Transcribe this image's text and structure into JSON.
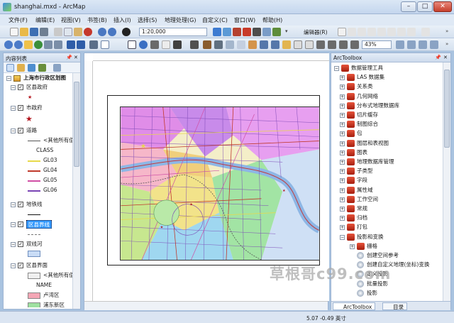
{
  "window": {
    "title": "shanghai.mxd - ArcMap"
  },
  "menu": [
    "文件(F)",
    "编辑(E)",
    "视图(V)",
    "书签(B)",
    "插入(I)",
    "选择(S)",
    "地理处理(G)",
    "自定义(C)",
    "窗口(W)",
    "帮助(H)"
  ],
  "toolbar": {
    "scale": "1:20,000",
    "editor_label": "编辑器(R)",
    "zoom_percent": "43%"
  },
  "toc": {
    "title": "内容列表",
    "dataframe": "上海市行政区划图",
    "items": [
      {
        "label": "区县政府",
        "checked": true
      },
      {
        "label": "市政府",
        "checked": true
      },
      {
        "label": "道路",
        "checked": true
      },
      {
        "label": "<其他所有值>"
      },
      {
        "label": "CLASS"
      },
      {
        "label": "GL03"
      },
      {
        "label": "GL04"
      },
      {
        "label": "GL05"
      },
      {
        "label": "GL06"
      },
      {
        "label": "地铁线",
        "checked": true
      },
      {
        "label": "区县界线",
        "checked": true,
        "selected": true
      },
      {
        "label": "双线河",
        "checked": true
      },
      {
        "label": "区县界面",
        "checked": true
      },
      {
        "label": "<其他所有值>"
      },
      {
        "label": "NAME"
      },
      {
        "label": "卢湾区"
      },
      {
        "label": "浦东新区"
      },
      {
        "label": "虹口区"
      }
    ],
    "colors": {
      "gl03": "#e8d94a",
      "gl04": "#c0392b",
      "gl05": "#d04fa5",
      "gl06": "#7a45b5",
      "luwan": "#f4a6b5",
      "pudong": "#9ee0a0",
      "hongkou": "#c5d5f3"
    }
  },
  "toolbox": {
    "title": "ArcToolbox",
    "items": [
      {
        "label": "数据管理工具",
        "level": 0,
        "expanded": true
      },
      {
        "label": "LAS 数据集",
        "level": 1
      },
      {
        "label": "关系类",
        "level": 1
      },
      {
        "label": "几何网络",
        "level": 1
      },
      {
        "label": "分布式地理数据库",
        "level": 1
      },
      {
        "label": "切片缓存",
        "level": 1
      },
      {
        "label": "制图综合",
        "level": 1
      },
      {
        "label": "包",
        "level": 1
      },
      {
        "label": "图层和表视图",
        "level": 1
      },
      {
        "label": "图表",
        "level": 1
      },
      {
        "label": "地理数据库管理",
        "level": 1
      },
      {
        "label": "子类型",
        "level": 1
      },
      {
        "label": "字段",
        "level": 1
      },
      {
        "label": "属性域",
        "level": 1
      },
      {
        "label": "工作空间",
        "level": 1
      },
      {
        "label": "常规",
        "level": 1
      },
      {
        "label": "归档",
        "level": 1
      },
      {
        "label": "打包",
        "level": 1
      },
      {
        "label": "投影和变换",
        "level": 1,
        "expanded": true
      },
      {
        "label": "栅格",
        "level": 2
      },
      {
        "label": "创建空间参考",
        "level": 2,
        "tool": true
      },
      {
        "label": "创建自定义地理(坐标)变换",
        "level": 2,
        "tool": true
      },
      {
        "label": "定义投影",
        "level": 2,
        "tool": true
      },
      {
        "label": "批量投影",
        "level": 2,
        "tool": true
      },
      {
        "label": "投影",
        "level": 2,
        "tool": true
      }
    ],
    "tabs": [
      "ArcToolbox",
      "目录"
    ]
  },
  "status": {
    "coords": "5.07  -0.49 英寸"
  },
  "watermark": "草根哥c99.com"
}
